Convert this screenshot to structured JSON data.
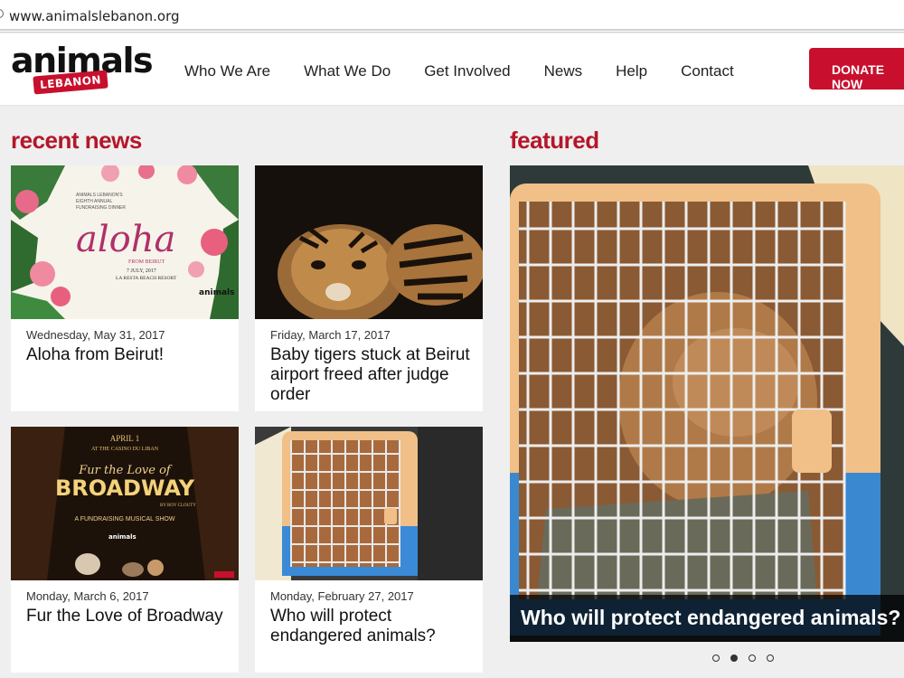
{
  "browser": {
    "url": "www.animalslebanon.org"
  },
  "header": {
    "logo_word": "animals",
    "logo_tag": "LEBANON",
    "nav": [
      "Who We Are",
      "What We Do",
      "Get Involved",
      "News",
      "Help",
      "Contact"
    ],
    "donate_label": "DONATE NOW"
  },
  "recent": {
    "title": "recent news",
    "items": [
      {
        "date": "Wednesday, May 31, 2017",
        "title": "Aloha from Beirut!",
        "image": "aloha-poster"
      },
      {
        "date": "Friday, March 17, 2017",
        "title": "Baby tigers stuck at Beirut airport freed after judge order",
        "image": "tiger-cub"
      },
      {
        "date": "Monday, March 6, 2017",
        "title": "Fur the Love of Broadway",
        "image": "broadway-poster"
      },
      {
        "date": "Monday, February 27, 2017",
        "title": "Who will protect endangered animals?",
        "image": "caged-animal"
      }
    ]
  },
  "featured": {
    "title": "featured",
    "caption": "Who will protect endangered animals?",
    "slides": 4,
    "active_slide": 2
  },
  "images": {
    "aloha": {
      "headline": "aloha",
      "sub": "FROM BEIRUT",
      "line1": "ANIMALS LEBANON'S",
      "line2": "EIGHTH ANNUAL",
      "line3": "FUNDRAISING DINNER",
      "date": "7 JULY, 2017",
      "venue": "LA RESTA BEACH RESORT",
      "brand": "animals"
    },
    "broadway": {
      "top": "APRIL 1",
      "sub": "AT THE CASINO DU LIBAN",
      "line1": "Fur the Love of",
      "line2": "BROADWAY",
      "by": "BY ROY CLOUTY",
      "tag": "A FUNDRAISING MUSICAL SHOW",
      "brand": "animals"
    }
  },
  "colors": {
    "brand_red": "#c8102e",
    "section_red": "#b5162a"
  }
}
